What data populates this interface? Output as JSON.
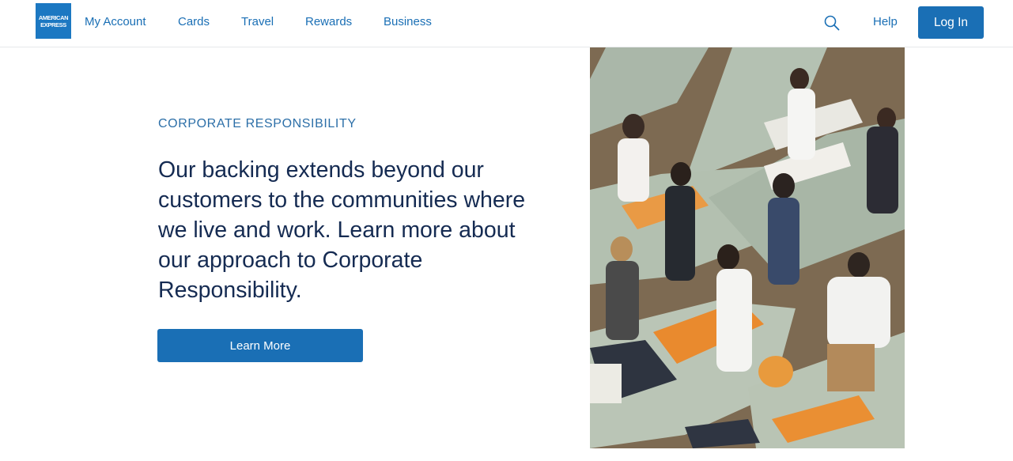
{
  "brand": {
    "logo_line1": "AMERICAN",
    "logo_line2": "EXPRESS",
    "color": "#1c78c2"
  },
  "nav": {
    "items": [
      {
        "label": "My Account"
      },
      {
        "label": "Cards"
      },
      {
        "label": "Travel"
      },
      {
        "label": "Rewards"
      },
      {
        "label": "Business"
      }
    ],
    "search_icon": "search-icon",
    "help_label": "Help",
    "login_label": "Log In"
  },
  "hero": {
    "eyebrow": "CORPORATE RESPONSIBILITY",
    "headline": "Our backing extends beyond our customers to the communities where we live and work. Learn more about our approach to Corporate Responsibility.",
    "cta_label": "Learn More",
    "accent_color": "#1a6fb5",
    "headline_color": "#152b52"
  }
}
